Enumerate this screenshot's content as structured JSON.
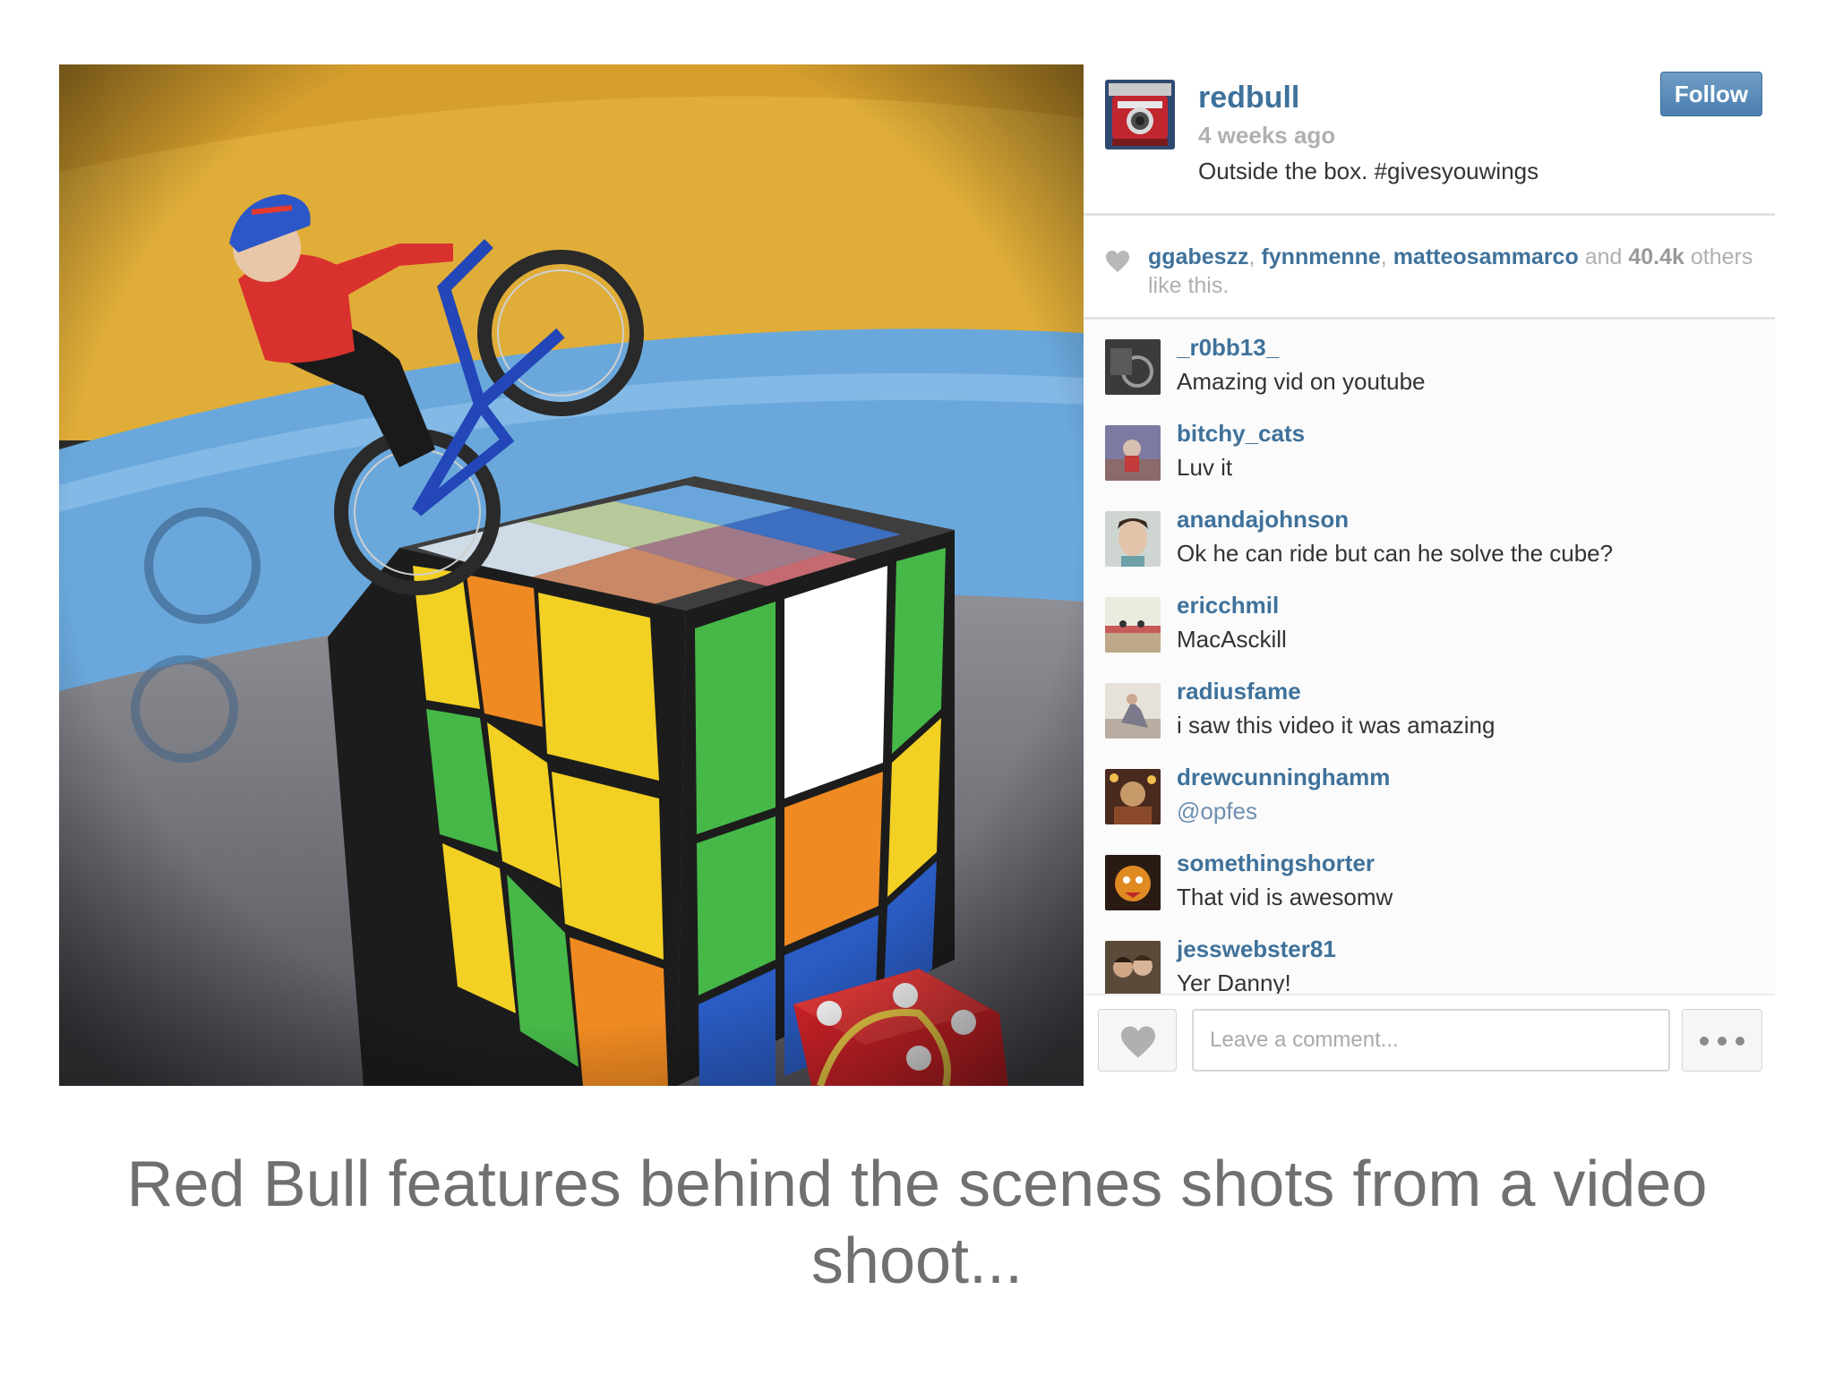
{
  "post": {
    "username": "redbull",
    "time": "4 weeks ago",
    "caption": "Outside the box. #givesyouwings",
    "follow_label": "Follow"
  },
  "likes": {
    "users": [
      "ggabeszz",
      "fynnmenne",
      "matteosammarco"
    ],
    "sep": ",",
    "and": "and",
    "count": "40.4k",
    "suffix": "others like this."
  },
  "comments": [
    {
      "user": "_r0bb13_",
      "text": "Amazing vid on youtube"
    },
    {
      "user": "bitchy_cats",
      "text": "Luv it"
    },
    {
      "user": "anandajohnson",
      "text": "Ok he can ride but can he solve the cube?"
    },
    {
      "user": "ericchmil",
      "text": "MacAsckill"
    },
    {
      "user": "radiusfame",
      "text": "i saw this video it was amazing"
    },
    {
      "user": "drewcunninghamm",
      "text": "@opfes"
    },
    {
      "user": "somethingshorter",
      "text": "That vid is awesomw"
    },
    {
      "user": "jesswebster81",
      "text": "Yer Danny!"
    }
  ],
  "footer": {
    "comment_placeholder": "Leave a comment..."
  },
  "slide_caption": "Red Bull features behind the scenes shots from a video shoot...",
  "icons": {
    "like": "heart-icon",
    "more": "more-dots-icon"
  },
  "colors": {
    "link": "#3f729b",
    "follow_button": "#5a8bbb",
    "muted": "#b0b0b0",
    "caption_text": "#707070"
  }
}
